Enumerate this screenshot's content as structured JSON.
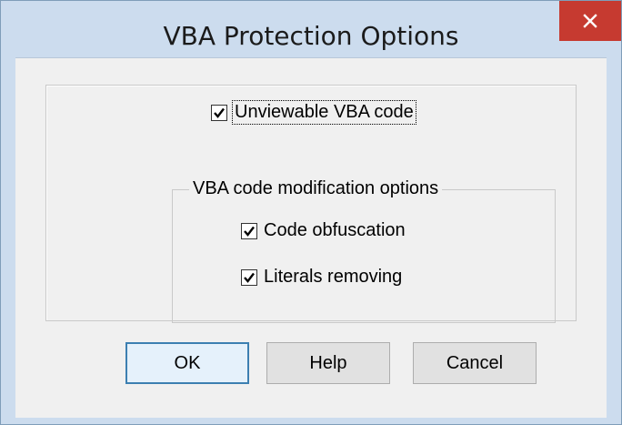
{
  "window": {
    "title": "VBA Protection Options"
  },
  "options": {
    "unviewable": {
      "label": "Unviewable VBA code",
      "checked": true
    },
    "group_label": "VBA code modification options",
    "obfuscation": {
      "label": "Code obfuscation",
      "checked": true
    },
    "literals": {
      "label": "Literals removing",
      "checked": true
    }
  },
  "buttons": {
    "ok": "OK",
    "help": "Help",
    "cancel": "Cancel"
  },
  "icons": {
    "close": "close-icon",
    "check": "checkmark-icon"
  },
  "colors": {
    "titlebar": "#ccdcee",
    "close_button": "#c63a30",
    "dialog_bg": "#f0f0f0"
  }
}
